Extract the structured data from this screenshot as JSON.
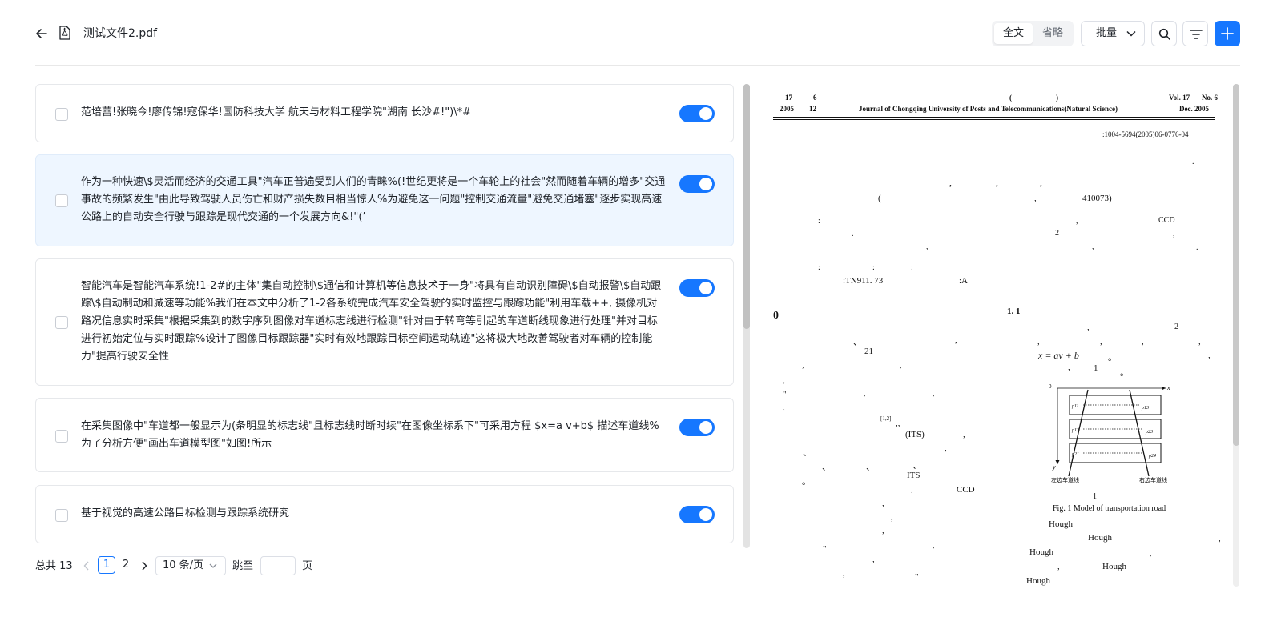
{
  "header": {
    "file_name": "测试文件2.pdf",
    "view_full": "全文",
    "view_brief": "省略",
    "batch_label": "批量",
    "colors": {
      "accent": "#1677ff"
    }
  },
  "paragraphs": [
    {
      "text": "范培蕾!张晓今!廖传锦!寇保华!国防科技大学 航天与材料工程学院\"湖南 长沙#!\")\\*#",
      "checked": false,
      "enabled": true,
      "selected": false
    },
    {
      "text": "作为一种快速\\$灵活而经济的交通工具\"汽车正普遍受到人们的青睐%(!世纪更将是一个车轮上的社会\"然而随着车辆的增多\"交通事故的频繁发生\"由此导致驾驶人员伤亡和财产损失数目相当惊人%为避免这一问题\"控制交通流量\"避免交通堵塞\"逐步实现高速公路上的自动安全行驶与跟踪是现代交通的一个发展方向&!\"(’",
      "checked": false,
      "enabled": true,
      "selected": true
    },
    {
      "text": "智能汽车是智能汽车系统!1-2#的主体\"集自动控制\\$通信和计算机等信息技术于一身\"将具有自动识别障碍\\$自动报警\\$自动跟踪\\$自动制动和减速等功能%我们在本文中分析了1-2各系统完成汽车安全驾驶的实时监控与跟踪功能\"利用车载++, 摄像机对路况信息实时采集\"根据采集到的数字序列图像对车道标志线进行检测\"针对由于转弯等引起的车道断线现象进行处理\"并对目标进行初始定位与实时跟踪%设计了图像目标跟踪器\"实时有效地跟踪目标空间运动轨迹\"这将极大地改善驾驶者对车辆的控制能力\"提高行驶安全性",
      "checked": false,
      "enabled": true,
      "selected": false
    },
    {
      "text": "在采集图像中\"车道都一般显示为(条明显的标志线\"且标志线时断时续\"在图像坐标系下\"可采用方程 $x=a v+b$ 描述车道线%为了分析方便\"画出车道模型图\"如图!所示",
      "checked": false,
      "enabled": true,
      "selected": false
    },
    {
      "text": "基于视觉的高速公路目标检测与跟踪系统研究",
      "checked": false,
      "enabled": true,
      "selected": false
    }
  ],
  "pagination": {
    "total_label": "总共 13",
    "pages": [
      "1",
      "2"
    ],
    "current_page": "1",
    "page_size": "10 条/页",
    "jump_label": "跳至",
    "page_suffix": "页",
    "jump_value": ""
  },
  "pdf": {
    "hdr_l1": "17",
    "hdr_l2": "6",
    "hdr_paren_l": "(",
    "hdr_paren_r": ")",
    "hdr_vol": "Vol. 17",
    "hdr_no": "No. 6",
    "hdr_year": "2005",
    "hdr_month": "12",
    "journal": "Journal of Chongqing University of Posts and Telecommunications(Natural Science)",
    "hdr_date": "Dec. 2005",
    "article_id": ":1004-5694(2005)06-0776-04",
    "postcode": "410073)",
    "paren_open": "(",
    "ccd1": "CCD",
    "num2": "2",
    "clc": ":TN911. 73",
    "doc_code": ":A",
    "sec0": "0",
    "sec11": "1. 1",
    "num2b": "2",
    "ref21": "21",
    "equation": "x = av + b",
    "fig_one": "1",
    "ref12": "[1,2]",
    "its1": "(ITS)",
    "its2": "ITS",
    "ccd2": "CCD",
    "fig_label_left": "左边车道线",
    "fig_label_right": "右边车道线",
    "fig_num": "1",
    "fig_caption": "Fig. 1  Model of transportation road",
    "fig_axis_x": "x",
    "fig_axis_y": "y",
    "fig_origin": "0",
    "fig_p_tl": "p11",
    "fig_p_tr": "p13",
    "fig_p_ml": "p12",
    "fig_p_mr": "p23",
    "fig_p_bl": "p21",
    "fig_p_br": "p24",
    "hough": "Hough"
  }
}
